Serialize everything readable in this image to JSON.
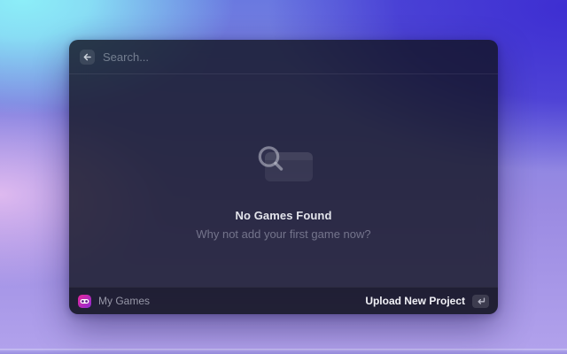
{
  "app": {
    "search": {
      "placeholder": "Search..."
    },
    "empty_state": {
      "title": "No Games Found",
      "subtitle": "Why not add your first game now?"
    },
    "footer": {
      "section_label": "My Games",
      "action_label": "Upload New Project"
    },
    "icons": {
      "back": "arrow-left-icon",
      "empty": "magnifier-over-card-icon",
      "logo": "goggles-app-logo-icon",
      "action_key": "enter-key-icon"
    },
    "colors": {
      "logo_magenta": "#e7289b",
      "logo_purple": "#8d2bd4",
      "bg_cyan": "#8ceef8",
      "bg_indigo": "#3e2ed2",
      "bg_pink": "#e2bcf0",
      "bg_lavender": "#b2a2ec"
    }
  }
}
